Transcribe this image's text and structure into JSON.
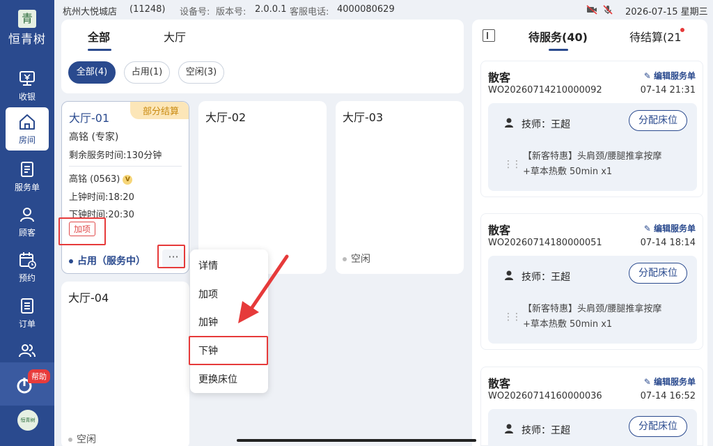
{
  "sidebar": {
    "logo_char": "青",
    "logo_text": "恒青树",
    "items": [
      {
        "label": "收银",
        "icon": "cashier-icon"
      },
      {
        "label": "房间",
        "icon": "home-icon"
      },
      {
        "label": "服务单",
        "icon": "service-order-icon"
      },
      {
        "label": "顾客",
        "icon": "customer-icon"
      },
      {
        "label": "预约",
        "icon": "calendar-icon"
      },
      {
        "label": "订单",
        "icon": "order-icon"
      },
      {
        "label": "",
        "icon": "staff-icon"
      }
    ],
    "active": "房间",
    "help_label": "帮助",
    "footer_logo": "恒青树"
  },
  "status_bar": {
    "store": "杭州大悦城店",
    "store_code": "(11248)",
    "device_label": "设备号:",
    "version_label": "版本号:",
    "version": "2.0.0.1",
    "phone_label": "客服电话:",
    "phone": "4000080629",
    "datetime": "2026-07-15 星期三"
  },
  "area_tabs": [
    {
      "label": "全部",
      "active": true
    },
    {
      "label": "大厅",
      "active": false
    }
  ],
  "filters": [
    {
      "label": "全部(4)",
      "active": true
    },
    {
      "label": "占用(1)",
      "active": false
    },
    {
      "label": "空闲(3)",
      "active": false
    }
  ],
  "rooms": [
    {
      "name": "大厅-01",
      "badge": "部分结算",
      "therapist": "高铭 (专家)",
      "remaining": "剩余服务时间:130分钟",
      "customer": "高铭 (0563)",
      "vip": "V",
      "start": "上钟时间:18:20",
      "end": "下钟时间:20:30",
      "tag": "加项",
      "status": "占用（服务中）",
      "more": "···"
    },
    {
      "name": "大厅-02",
      "status": ""
    },
    {
      "name": "大厅-03",
      "status": "空闲"
    },
    {
      "name": "大厅-04",
      "status": "空闲"
    }
  ],
  "context_menu": [
    "详情",
    "加项",
    "加钟",
    "下钟",
    "更换床位"
  ],
  "right_panel": {
    "tabs": [
      {
        "label": "待服务(40)",
        "active": true
      },
      {
        "label": "待结算(21",
        "active": false
      }
    ],
    "orders": [
      {
        "customer": "散客",
        "edit_label": "编辑服务单",
        "order_id": "WO20260714210000092",
        "time": "07-14 21:31",
        "tech": "技师：王超",
        "assign_label": "分配床位",
        "service_line1": "【新客特惠】头肩颈/腰腿推拿按摩",
        "service_line2": "+草本热敷 50min x1"
      },
      {
        "customer": "散客",
        "edit_label": "编辑服务单",
        "order_id": "WO20260714180000051",
        "time": "07-14 18:14",
        "tech": "技师：王超",
        "assign_label": "分配床位",
        "service_line1": "【新客特惠】头肩颈/腰腿推拿按摩",
        "service_line2": "+草本热敷 50min x1"
      },
      {
        "customer": "散客",
        "edit_label": "编辑服务单",
        "order_id": "WO20260714160000036",
        "time": "07-14 16:52",
        "tech": "技师：王超",
        "assign_label": "分配床位",
        "service_line1": "",
        "service_line2": ""
      }
    ]
  },
  "colors": {
    "primary": "#2a4a8e",
    "highlight_red": "#e63a3a",
    "badge_bg": "#fce6b8",
    "badge_text": "#c98a10"
  }
}
